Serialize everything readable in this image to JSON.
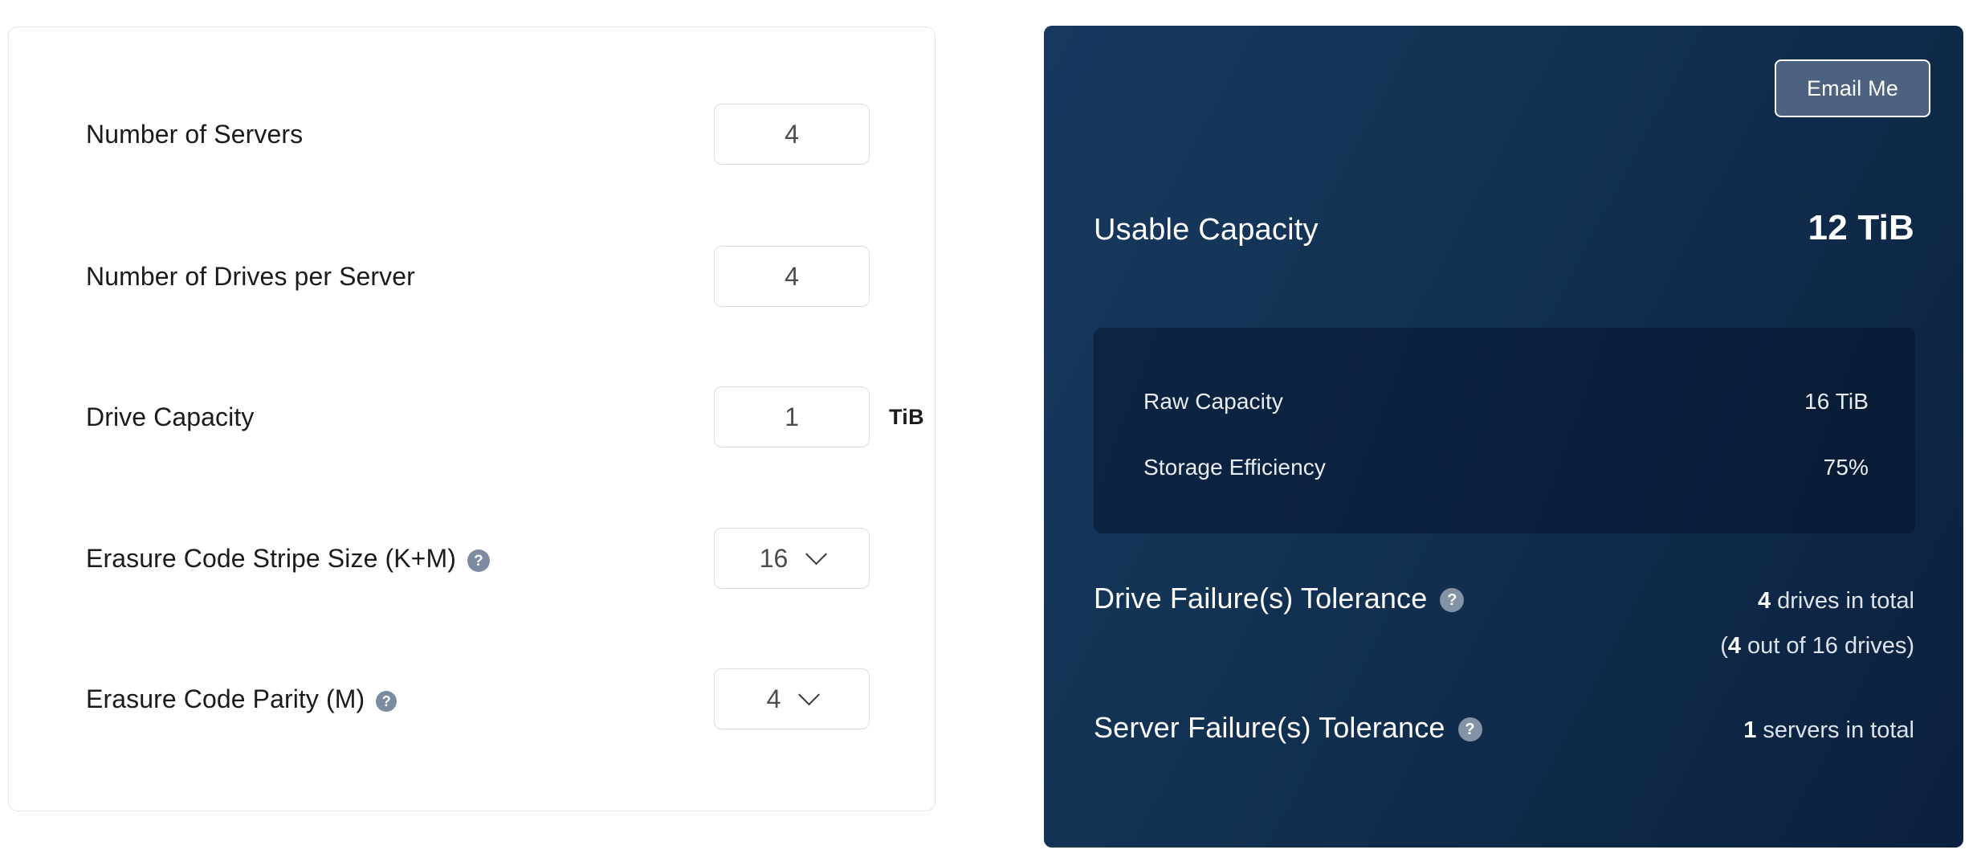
{
  "form": {
    "fields": [
      {
        "label": "Number of Servers",
        "control": "number",
        "value": "4",
        "unit": "",
        "has_help": false
      },
      {
        "label": "Number of Drives per Server",
        "control": "number",
        "value": "4",
        "unit": "",
        "has_help": false
      },
      {
        "label": "Drive Capacity",
        "control": "number",
        "value": "1",
        "unit": "TiB",
        "has_help": false
      },
      {
        "label": "Erasure Code Stripe Size (K+M)",
        "control": "select",
        "value": "16",
        "unit": "",
        "has_help": true,
        "help_icon": "question-mark-icon"
      },
      {
        "label": "Erasure Code Parity (M)",
        "control": "select",
        "value": "4",
        "unit": "",
        "has_help": true,
        "help_icon": "question-mark-icon"
      }
    ]
  },
  "results": {
    "email_button_label": "Email Me",
    "usable_capacity": {
      "label": "Usable Capacity",
      "value": "12 TiB"
    },
    "details": [
      {
        "label": "Raw Capacity",
        "value": "16 TiB"
      },
      {
        "label": "Storage Efficiency",
        "value": "75%"
      }
    ],
    "tolerances": [
      {
        "label": "Drive Failure(s) Tolerance",
        "help_icon": "question-mark-icon",
        "value_number": "4",
        "value_text": " drives in total",
        "sub_prefix": "(",
        "sub_number": "4",
        "sub_text": " out of 16 drives)"
      },
      {
        "label": "Server Failure(s) Tolerance",
        "help_icon": "question-mark-icon",
        "value_number": "1",
        "value_text": " servers in total",
        "sub_prefix": "",
        "sub_number": "",
        "sub_text": ""
      }
    ]
  },
  "colors": {
    "panel_navy_light": "#17395f",
    "panel_navy_dark": "#0b203e",
    "inner_box": "#0d2442",
    "button_fill": "#4d6180",
    "help_icon": "#7d8ba1",
    "card_border": "#e4e4e6",
    "input_border": "#dcdcde",
    "label_text": "#1b1b1d",
    "value_text": "#4b4b4f"
  }
}
